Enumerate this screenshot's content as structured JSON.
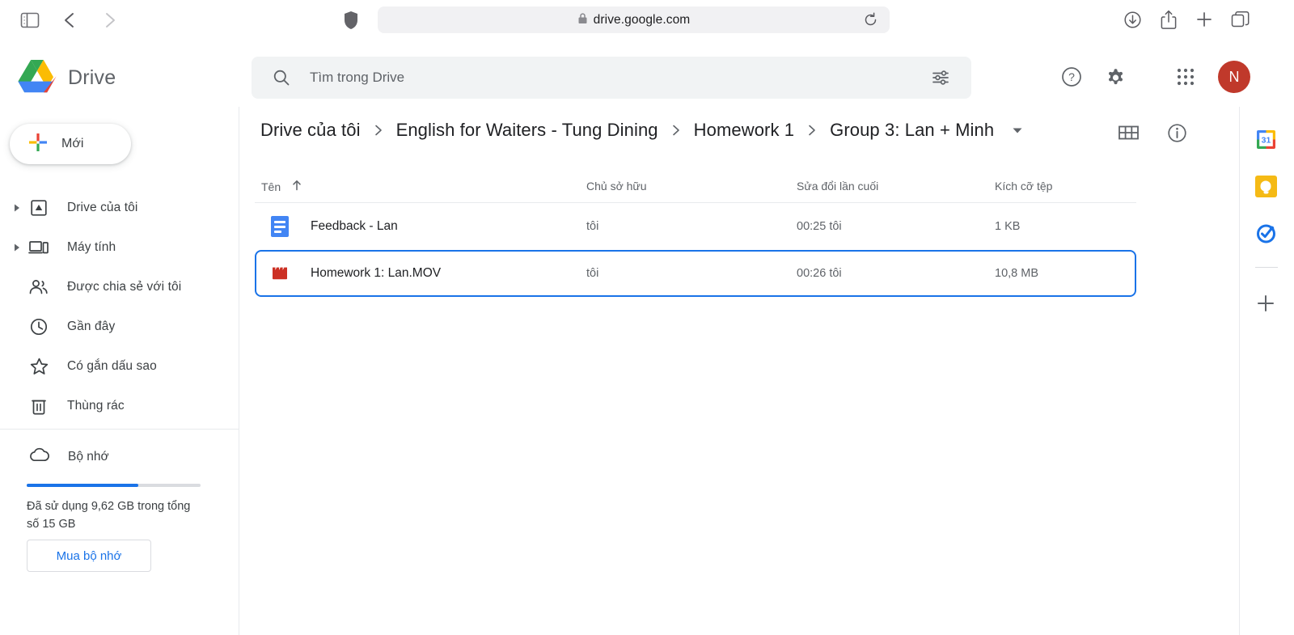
{
  "browser": {
    "url": "drive.google.com",
    "lock_icon": "lock-icon",
    "sidebar_toggle_icon": "sidebar-toggle-icon",
    "back_icon": "chevron-left-icon",
    "forward_icon": "chevron-right-icon",
    "shield_icon": "shield-icon",
    "reload_icon": "reload-icon",
    "downloads_icon": "download-icon",
    "share_icon": "share-icon",
    "new_tab_icon": "plus-icon",
    "tab_overview_icon": "tab-overview-icon"
  },
  "header": {
    "app_name": "Drive",
    "logo_icon": "google-drive-logo",
    "search": {
      "placeholder": "Tìm trong Drive",
      "value": "",
      "search_icon": "search-icon",
      "filter_icon": "tune-icon"
    },
    "help_icon": "help-icon",
    "settings_icon": "gear-icon",
    "apps_icon": "apps-grid-icon",
    "avatar_letter": "N",
    "avatar_color": "#c0392b"
  },
  "sidebar": {
    "new_button": "Mới",
    "items": [
      {
        "label": "Drive của tôi",
        "icon": "my-drive-icon",
        "has_arrow": true
      },
      {
        "label": "Máy tính",
        "icon": "computers-icon",
        "has_arrow": true
      },
      {
        "label": "Được chia sẻ với tôi",
        "icon": "shared-icon",
        "has_arrow": false
      },
      {
        "label": "Gần đây",
        "icon": "clock-icon",
        "has_arrow": false
      },
      {
        "label": "Có gắn dấu sao",
        "icon": "star-icon",
        "has_arrow": false
      },
      {
        "label": "Thùng rác",
        "icon": "trash-icon",
        "has_arrow": false
      }
    ],
    "storage": {
      "label": "Bộ nhớ",
      "icon": "cloud-icon",
      "usage_text": "Đã sử dụng 9,62 GB trong tổng số 15 GB",
      "used_percent": 64,
      "buy_button": "Mua bộ nhớ",
      "bar_color": "#1a73e8"
    }
  },
  "main": {
    "breadcrumb": [
      "Drive của tôi",
      "English for Waiters - Tung Dining",
      "Homework 1",
      "Group 3: Lan + Minh"
    ],
    "breadcrumb_caret_icon": "chevron-down-icon",
    "grid_view_icon": "grid-view-icon",
    "info_icon": "info-icon",
    "columns": {
      "name": "Tên",
      "owner": "Chủ sở hữu",
      "modified": "Sửa đổi lần cuối",
      "size": "Kích cỡ tệp",
      "sort_icon": "arrow-up-icon"
    },
    "files": [
      {
        "name": "Feedback - Lan",
        "owner": "tôi",
        "modified": "00:25 tôi",
        "size": "1 KB",
        "icon": "google-docs-icon",
        "selected": false
      },
      {
        "name": "Homework 1: Lan.MOV",
        "owner": "tôi",
        "modified": "00:26 tôi",
        "size": "10,8 MB",
        "icon": "video-file-icon",
        "selected": true
      }
    ],
    "selection_color": "#1a73e8"
  },
  "right_rail": {
    "items": [
      {
        "name": "google-calendar-icon",
        "label": "31"
      },
      {
        "name": "google-keep-icon",
        "label": ""
      },
      {
        "name": "google-tasks-icon",
        "label": ""
      }
    ],
    "add_icon": "plus-icon"
  }
}
